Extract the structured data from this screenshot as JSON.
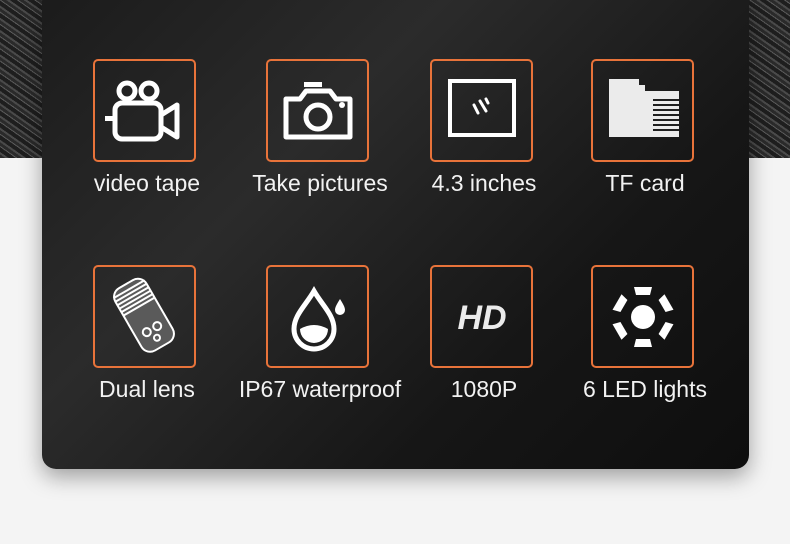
{
  "accent_color": "#e8733a",
  "features": [
    {
      "label": "video tape",
      "icon": "video-camera-icon"
    },
    {
      "label": "Take pictures",
      "icon": "camera-icon"
    },
    {
      "label": "4.3 inches",
      "icon": "screen-icon"
    },
    {
      "label": "TF card",
      "icon": "sd-card-icon"
    },
    {
      "label": "Dual lens",
      "icon": "endoscope-lens-icon"
    },
    {
      "label": "IP67 waterproof",
      "icon": "water-drop-icon"
    },
    {
      "label": "1080P",
      "icon": "hd-icon",
      "icon_text": "HD"
    },
    {
      "label": "6 LED lights",
      "icon": "led-ring-icon"
    }
  ]
}
